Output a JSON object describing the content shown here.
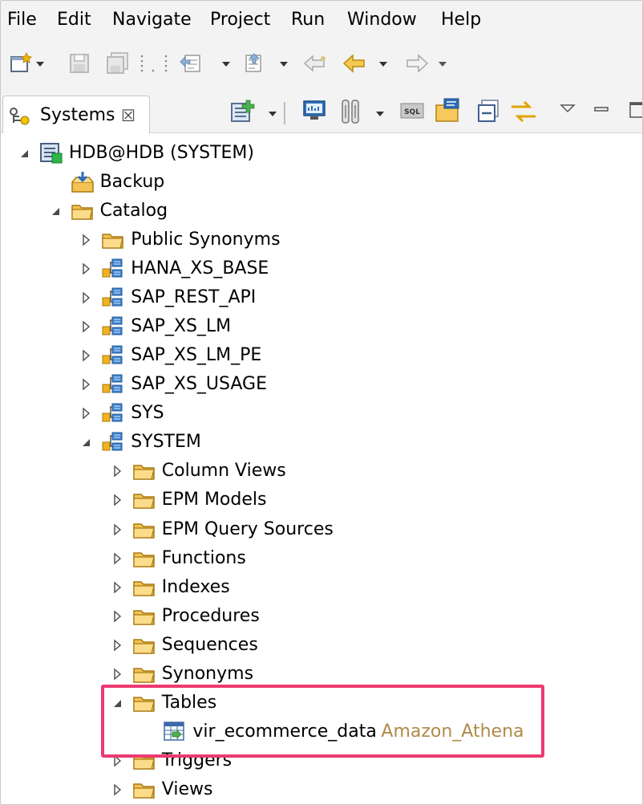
{
  "menu": [
    "File",
    "Edit",
    "Navigate",
    "Project",
    "Run",
    "Window",
    "Help"
  ],
  "tab": {
    "label": "Systems",
    "close_glyph": "☒"
  },
  "tree": [
    {
      "label": "HDB@HDB (SYSTEM)",
      "icon": "system-icon",
      "level": 0,
      "state": "expanded"
    },
    {
      "label": "Backup",
      "icon": "backup-icon",
      "level": 1,
      "state": "leaf"
    },
    {
      "label": "Catalog",
      "icon": "folder-icon",
      "level": 1,
      "state": "expanded"
    },
    {
      "label": "Public Synonyms",
      "icon": "folder-icon",
      "level": 2,
      "state": "collapsed"
    },
    {
      "label": "HANA_XS_BASE",
      "icon": "schema-icon",
      "level": 2,
      "state": "collapsed"
    },
    {
      "label": "SAP_REST_API",
      "icon": "schema-icon",
      "level": 2,
      "state": "collapsed"
    },
    {
      "label": "SAP_XS_LM",
      "icon": "schema-icon",
      "level": 2,
      "state": "collapsed"
    },
    {
      "label": "SAP_XS_LM_PE",
      "icon": "schema-icon",
      "level": 2,
      "state": "collapsed"
    },
    {
      "label": "SAP_XS_USAGE",
      "icon": "schema-icon",
      "level": 2,
      "state": "collapsed"
    },
    {
      "label": "SYS",
      "icon": "schema-icon",
      "level": 2,
      "state": "collapsed"
    },
    {
      "label": "SYSTEM",
      "icon": "schema-icon",
      "level": 2,
      "state": "expanded"
    },
    {
      "label": "Column Views",
      "icon": "folder-icon",
      "level": 3,
      "state": "collapsed"
    },
    {
      "label": "EPM Models",
      "icon": "folder-icon",
      "level": 3,
      "state": "collapsed"
    },
    {
      "label": "EPM Query Sources",
      "icon": "folder-icon",
      "level": 3,
      "state": "collapsed"
    },
    {
      "label": "Functions",
      "icon": "folder-icon",
      "level": 3,
      "state": "collapsed"
    },
    {
      "label": "Indexes",
      "icon": "folder-icon",
      "level": 3,
      "state": "collapsed"
    },
    {
      "label": "Procedures",
      "icon": "folder-icon",
      "level": 3,
      "state": "collapsed"
    },
    {
      "label": "Sequences",
      "icon": "folder-icon",
      "level": 3,
      "state": "collapsed"
    },
    {
      "label": "Synonyms",
      "icon": "folder-icon",
      "level": 3,
      "state": "collapsed"
    },
    {
      "label": "Tables",
      "icon": "folder-icon",
      "level": 3,
      "state": "expanded"
    },
    {
      "label": "vir_ecommerce_data",
      "decoration": "Amazon_Athena",
      "icon": "virtual-table-icon",
      "level": 4,
      "state": "leaf"
    },
    {
      "label": "Triggers",
      "icon": "folder-icon",
      "level": 3,
      "state": "collapsed"
    },
    {
      "label": "Views",
      "icon": "folder-icon",
      "level": 3,
      "state": "collapsed"
    }
  ],
  "colors": {
    "highlight": "#ec3a71",
    "decoration_text": "#b08a4a",
    "chrome_bg": "#f3f3f3"
  }
}
